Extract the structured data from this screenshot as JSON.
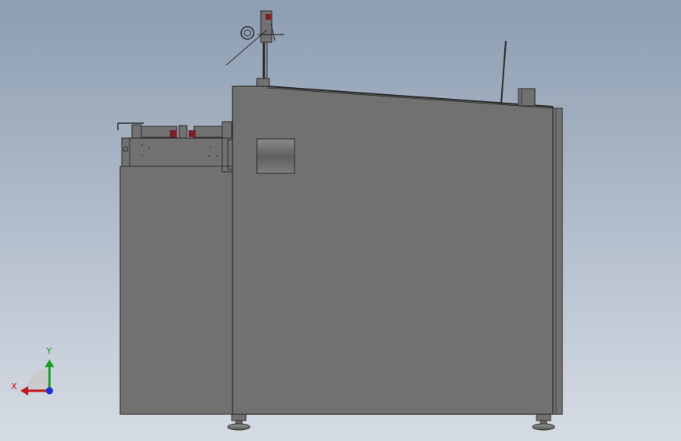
{
  "window": {
    "title": ""
  },
  "viewport": {
    "background_top": "#8d9db2",
    "background_bottom": "#d6dce4"
  },
  "model": {
    "body_color": "#717171",
    "edge_color": "#2b2b2b",
    "accent_red": "#7a1f24",
    "roller_color": "#6b6b6b"
  },
  "triad": {
    "x_label": "X",
    "y_label": "Y",
    "x_color": "#c0161c",
    "y_color": "#1b9a2a",
    "z_color": "#1a2fd0"
  }
}
